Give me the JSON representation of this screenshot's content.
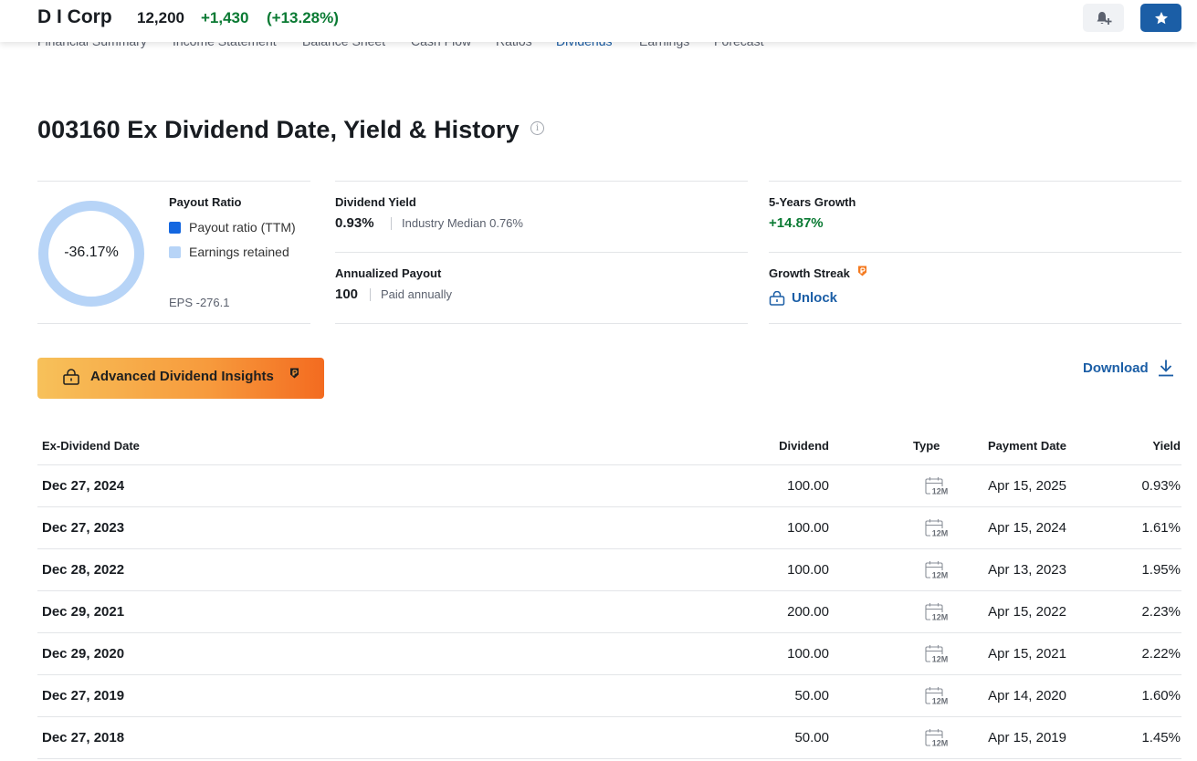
{
  "header": {
    "company": "D I Corp",
    "price": "12,200",
    "change": "+1,430",
    "change_pct": "(+13.28%)",
    "alert_icon": "bell-plus-icon",
    "watch_icon": "star-icon"
  },
  "subnav": {
    "tabs": [
      {
        "label": "Financial Summary"
      },
      {
        "label": "Income Statement"
      },
      {
        "label": "Balance Sheet"
      },
      {
        "label": "Cash Flow"
      },
      {
        "label": "Ratios"
      },
      {
        "label": "Dividends"
      },
      {
        "label": "Earnings"
      },
      {
        "label": "Forecast"
      }
    ],
    "active": "Dividends"
  },
  "page": {
    "title": "003160 Ex Dividend Date, Yield & History",
    "info_glyph": "i"
  },
  "payout": {
    "label": "Payout Ratio",
    "value": "-36.17%",
    "fraction_shown": 0,
    "legend_ttm": "Payout ratio (TTM)",
    "legend_retained": "Earnings retained",
    "eps": "EPS -276.1",
    "colors": {
      "ttm": "#1467e0",
      "retained": "#b7d4f7"
    }
  },
  "dividend_yield": {
    "label": "Dividend Yield",
    "value": "0.93%",
    "sub": "Industry Median 0.76%"
  },
  "annualized_payout": {
    "label": "Annualized Payout",
    "value": "100",
    "sub": "Paid annually"
  },
  "growth": {
    "label": "5-Years Growth",
    "value": "+14.87%"
  },
  "streak": {
    "label": "Growth Streak",
    "unlock": "Unlock"
  },
  "insights": {
    "label": "Advanced Dividend Insights"
  },
  "download": {
    "label": "Download"
  },
  "table": {
    "columns": {
      "ex_date": "Ex-Dividend Date",
      "dividend": "Dividend",
      "type": "Type",
      "payment": "Payment Date",
      "yield": "Yield"
    },
    "type_icon_text": "12M",
    "rows": [
      {
        "ex_date": "Dec 27, 2024",
        "dividend": "100.00",
        "payment": "Apr 15, 2025",
        "yield": "0.93%"
      },
      {
        "ex_date": "Dec 27, 2023",
        "dividend": "100.00",
        "payment": "Apr 15, 2024",
        "yield": "1.61%"
      },
      {
        "ex_date": "Dec 28, 2022",
        "dividend": "100.00",
        "payment": "Apr 13, 2023",
        "yield": "1.95%"
      },
      {
        "ex_date": "Dec 29, 2021",
        "dividend": "200.00",
        "payment": "Apr 15, 2022",
        "yield": "2.23%"
      },
      {
        "ex_date": "Dec 29, 2020",
        "dividend": "100.00",
        "payment": "Apr 15, 2021",
        "yield": "2.22%"
      },
      {
        "ex_date": "Dec 27, 2019",
        "dividend": "50.00",
        "payment": "Apr 14, 2020",
        "yield": "1.60%"
      },
      {
        "ex_date": "Dec 27, 2018",
        "dividend": "50.00",
        "payment": "Apr 15, 2019",
        "yield": "1.45%"
      }
    ]
  }
}
